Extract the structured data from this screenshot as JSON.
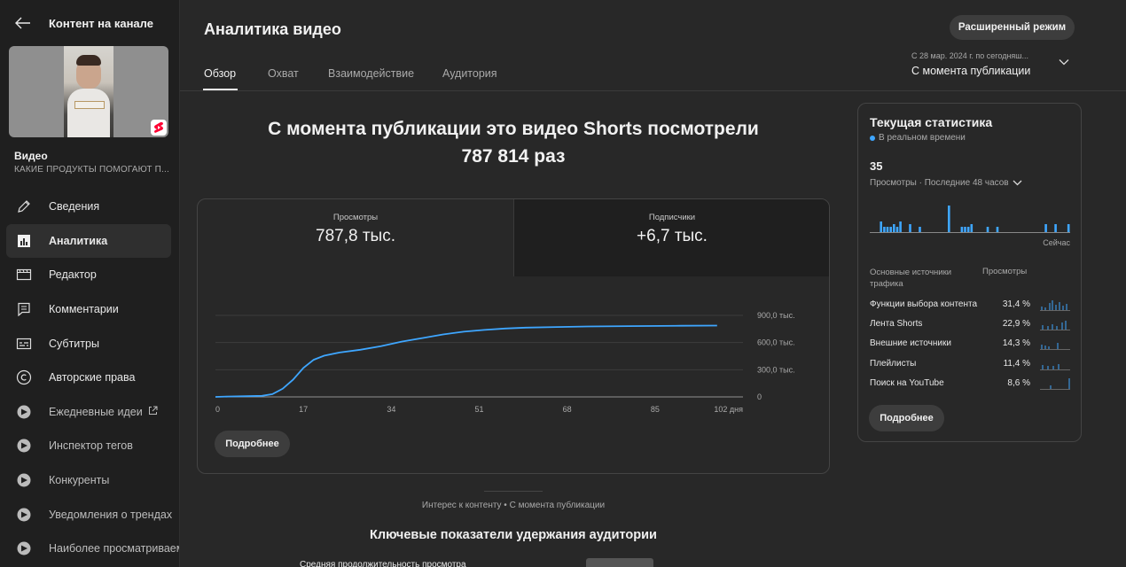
{
  "sidebar": {
    "title": "Контент на канале",
    "video_label": "Видео",
    "video_name": "КАКИЕ ПРОДУКТЫ ПОМОГАЮТ П...",
    "items": [
      {
        "label": "Сведения",
        "icon": "pencil-icon"
      },
      {
        "label": "Аналитика",
        "icon": "analytics-icon"
      },
      {
        "label": "Редактор",
        "icon": "editor-icon"
      },
      {
        "label": "Комментарии",
        "icon": "comments-icon"
      },
      {
        "label": "Субтитры",
        "icon": "subtitles-icon"
      },
      {
        "label": "Авторские права",
        "icon": "copyright-icon"
      },
      {
        "label": "Ежедневные идеи",
        "icon": "extension-icon"
      },
      {
        "label": "Инспектор тегов",
        "icon": "extension-icon"
      },
      {
        "label": "Конкуренты",
        "icon": "extension-icon"
      },
      {
        "label": "Уведомления о трендах",
        "icon": "extension-icon"
      },
      {
        "label": "Наиболее просматриваемые",
        "icon": "extension-icon"
      }
    ],
    "active_index": 1
  },
  "header": {
    "title": "Аналитика видео",
    "advanced_button": "Расширенный режим",
    "tabs": [
      "Обзор",
      "Охват",
      "Взаимодействие",
      "Аудитория"
    ],
    "date_range_small": "С 28 мар. 2024 г. по сегодняш...",
    "date_range_main": "С момента публикации"
  },
  "headline": {
    "line1": "С момента публикации это видео Shorts посмотрели",
    "line2": "787 814 раз"
  },
  "metrics": [
    {
      "label": "Просмотры",
      "value": "787,8 тыс."
    },
    {
      "label": "Подписчики",
      "value": "+6,7 тыс."
    }
  ],
  "chart_data": {
    "type": "line",
    "x_tick_labels": [
      "0",
      "17",
      "34",
      "51",
      "68",
      "85",
      "102 дня"
    ],
    "y_tick_labels": [
      "0",
      "300,0 тыс.",
      "600,0 тыс.",
      "900,0 тыс."
    ],
    "ylim": [
      0,
      900000
    ],
    "xlim": [
      0,
      102
    ],
    "series": [
      {
        "color": "#3ea6ff",
        "points": [
          [
            0,
            0
          ],
          [
            3,
            5000
          ],
          [
            6,
            8000
          ],
          [
            9,
            12000
          ],
          [
            11,
            30000
          ],
          [
            13,
            90000
          ],
          [
            15,
            190000
          ],
          [
            17,
            320000
          ],
          [
            19,
            410000
          ],
          [
            21,
            455000
          ],
          [
            24,
            490000
          ],
          [
            28,
            520000
          ],
          [
            32,
            560000
          ],
          [
            36,
            610000
          ],
          [
            40,
            650000
          ],
          [
            44,
            690000
          ],
          [
            48,
            720000
          ],
          [
            52,
            740000
          ],
          [
            56,
            755000
          ],
          [
            60,
            765000
          ],
          [
            66,
            772000
          ],
          [
            72,
            778000
          ],
          [
            80,
            782000
          ],
          [
            90,
            786000
          ],
          [
            97,
            787800
          ]
        ]
      }
    ]
  },
  "main_more": "Подробнее",
  "realtime": {
    "title": "Текущая статистика",
    "live": "В реальном времени",
    "count": "35",
    "subtitle": "Просмотры · Последние 48 часов",
    "now_label": "Сейчас",
    "bars": [
      0,
      0,
      0,
      4,
      2,
      2,
      2,
      3,
      2,
      4,
      0,
      0,
      3,
      0,
      0,
      2,
      0,
      0,
      0,
      0,
      0,
      0,
      0,
      0,
      10,
      0,
      0,
      0,
      2,
      2,
      2,
      3,
      0,
      0,
      0,
      0,
      2,
      0,
      0,
      2,
      0,
      0,
      0,
      0,
      0,
      0,
      0,
      0,
      0,
      0,
      0,
      0,
      0,
      0,
      3,
      0,
      0,
      3,
      0,
      0,
      0,
      3
    ]
  },
  "traffic": {
    "header_source": "Основные источники трафика",
    "header_views": "Просмотры",
    "sources": [
      {
        "name": "Функции выбора контента",
        "value": "31,4 %"
      },
      {
        "name": "Лента Shorts",
        "value": "22,9 %"
      },
      {
        "name": "Внешние источники",
        "value": "14,3 %"
      },
      {
        "name": "Плейлисты",
        "value": "11,4 %"
      },
      {
        "name": "Поиск на YouTube",
        "value": "8,6 %"
      }
    ],
    "more": "Подробнее"
  },
  "bottom": {
    "interest": "Интерес к контенту • С момента публикации",
    "retention_title": "Ключевые показатели удержания аудитории",
    "avg_duration": "Средняя продолжительность просмотра"
  },
  "colors": {
    "accent": "#3ea6ff",
    "background": "#282828",
    "sidebar": "#1f1f1f"
  }
}
